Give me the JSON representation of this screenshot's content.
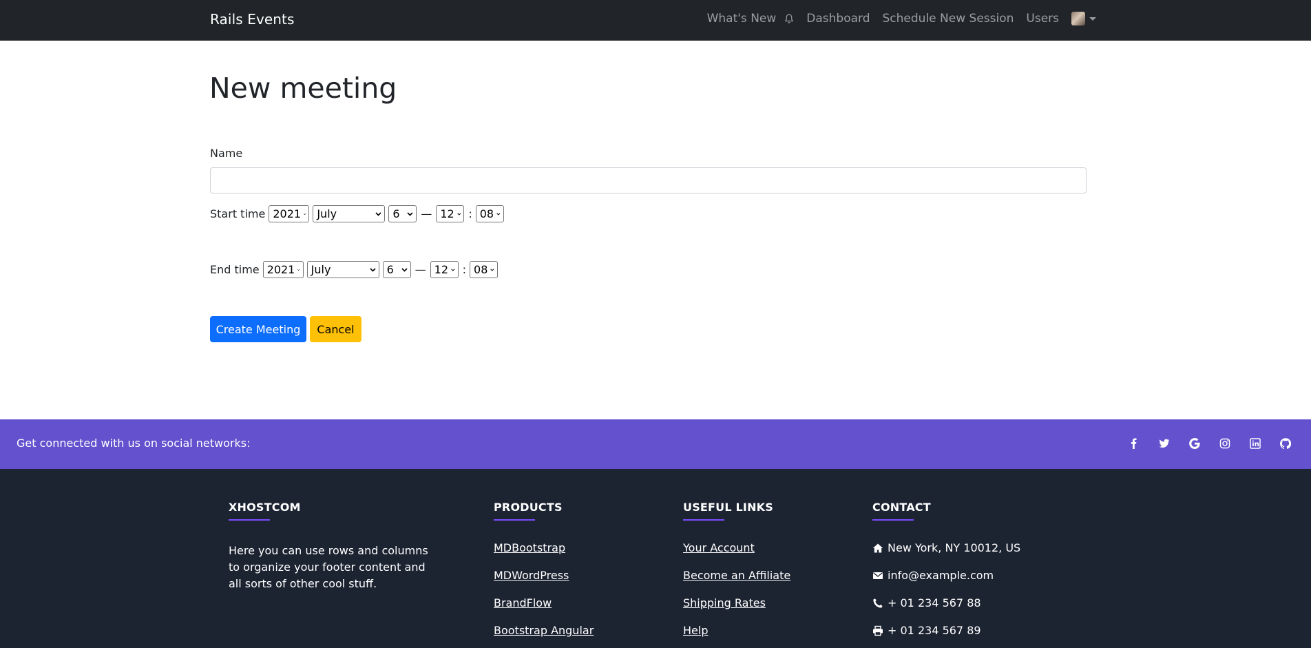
{
  "navbar": {
    "brand": "Rails Events",
    "links": {
      "whats_new": "What's New",
      "dashboard": "Dashboard",
      "schedule": "Schedule New Session",
      "users": "Users"
    },
    "bell_icon": "bell-icon",
    "avatar_icon": "avatar"
  },
  "form": {
    "title": "New meeting",
    "name_label": "Name",
    "name_value": "",
    "start": {
      "label": "Start time",
      "year": "2021",
      "month": "July",
      "day": "6",
      "sep": "—",
      "hour": "12",
      "colon": ":",
      "minute": "08"
    },
    "end": {
      "label": "End time",
      "year": "2021",
      "month": "July",
      "day": "6",
      "sep": "—",
      "hour": "12",
      "colon": ":",
      "minute": "08"
    },
    "create_label": "Create Meeting",
    "cancel_label": "Cancel",
    "colors": {
      "primary": "#0d6efd",
      "warning": "#ffc107"
    }
  },
  "social": {
    "text": "Get connected with us on social networks:",
    "icons": [
      "facebook-icon",
      "twitter-icon",
      "google-icon",
      "instagram-icon",
      "linkedin-icon",
      "github-icon"
    ],
    "bg": "#6351ce"
  },
  "footer": {
    "bg": "#1c2331",
    "company": {
      "title": "XHOSTCOM",
      "desc": "Here you can use rows and columns to organize your footer content and all sorts of other cool stuff."
    },
    "products": {
      "title": "PRODUCTS",
      "items": [
        "MDBootstrap",
        "MDWordPress",
        "BrandFlow",
        "Bootstrap Angular"
      ]
    },
    "useful": {
      "title": "USEFUL LINKS",
      "items": [
        "Your Account",
        "Become an Affiliate",
        "Shipping Rates",
        "Help"
      ]
    },
    "contact": {
      "title": "CONTACT",
      "address": "New York, NY 10012, US",
      "email": "info@example.com",
      "phone": "+ 01 234 567 88",
      "fax": "+ 01 234 567 89"
    }
  }
}
